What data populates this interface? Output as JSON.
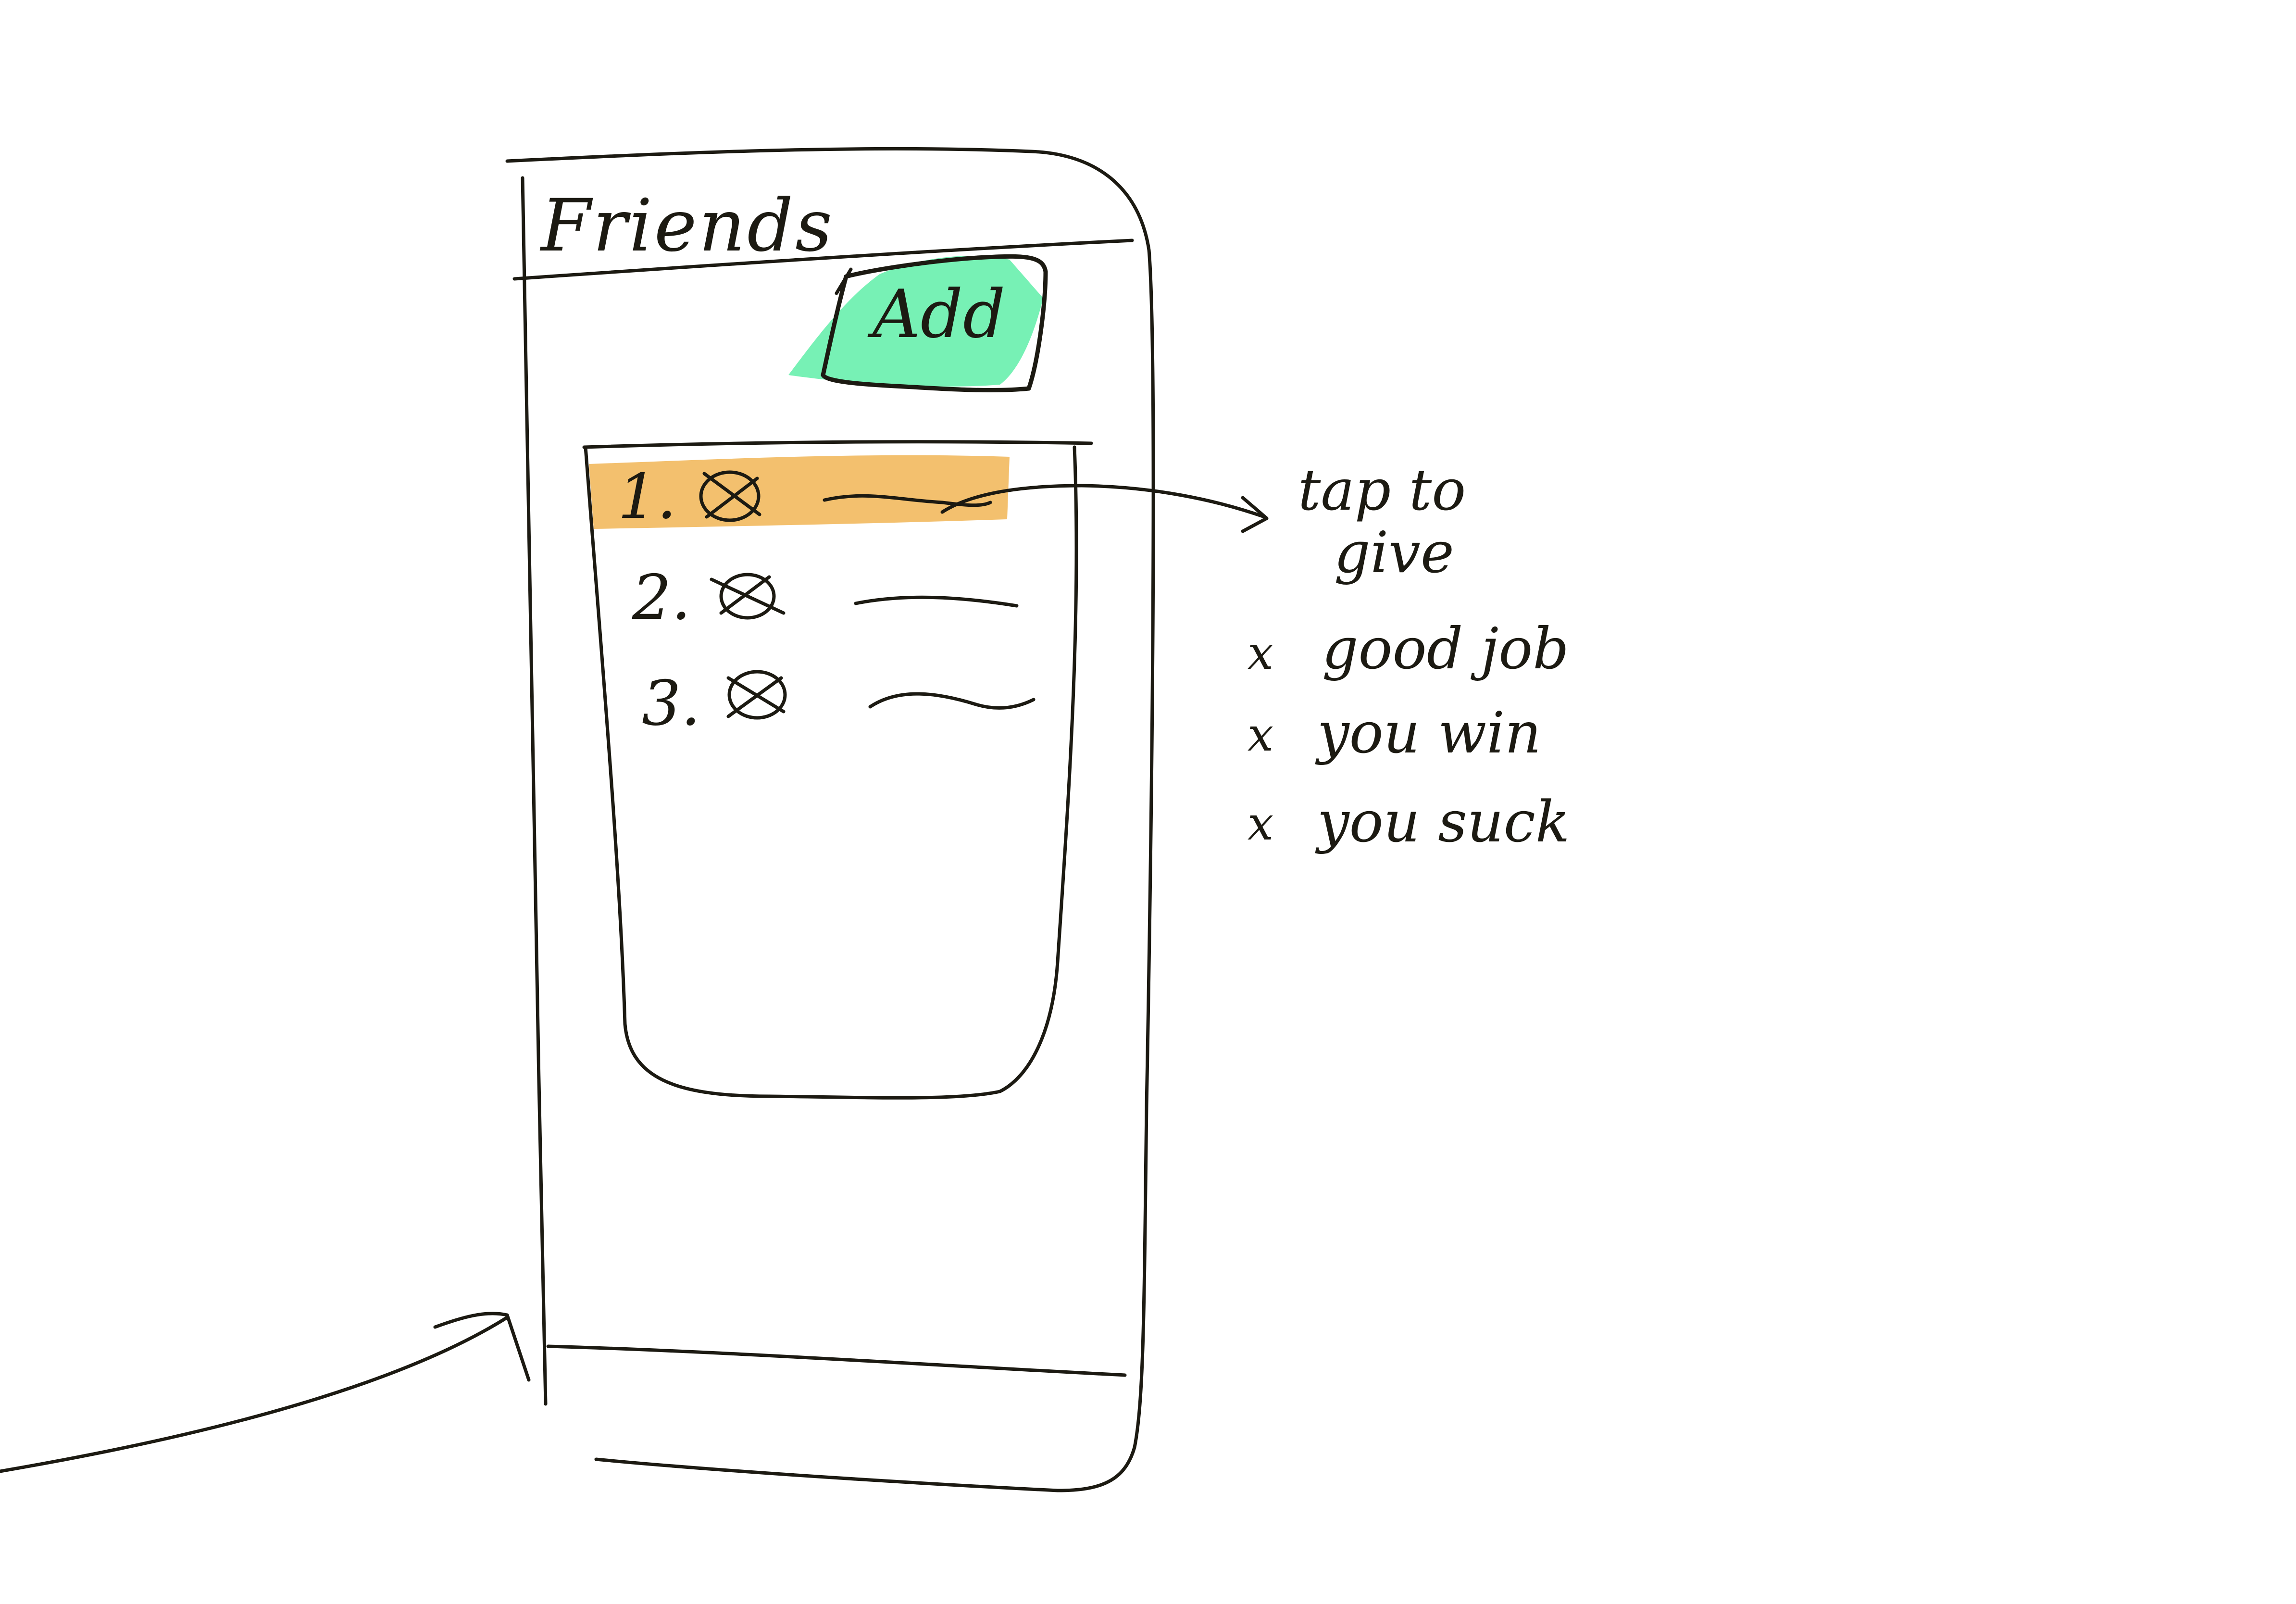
{
  "header": {
    "title": "Friends"
  },
  "toolbar": {
    "add_label": "Add"
  },
  "list": {
    "items": [
      {
        "number": "1.",
        "highlighted": true
      },
      {
        "number": "2.",
        "highlighted": false
      },
      {
        "number": "3.",
        "highlighted": false
      }
    ]
  },
  "annotation": {
    "lines": [
      "tap to",
      "give"
    ],
    "options": [
      {
        "marker": "x",
        "label": "good job"
      },
      {
        "marker": "x",
        "label": "you win"
      },
      {
        "marker": "x",
        "label": "you suck"
      }
    ]
  },
  "colors": {
    "ink": "#1c1a12",
    "add_highlight": "#5fefa8",
    "row_highlight": "#f3c06e",
    "background": "#ffffff"
  }
}
